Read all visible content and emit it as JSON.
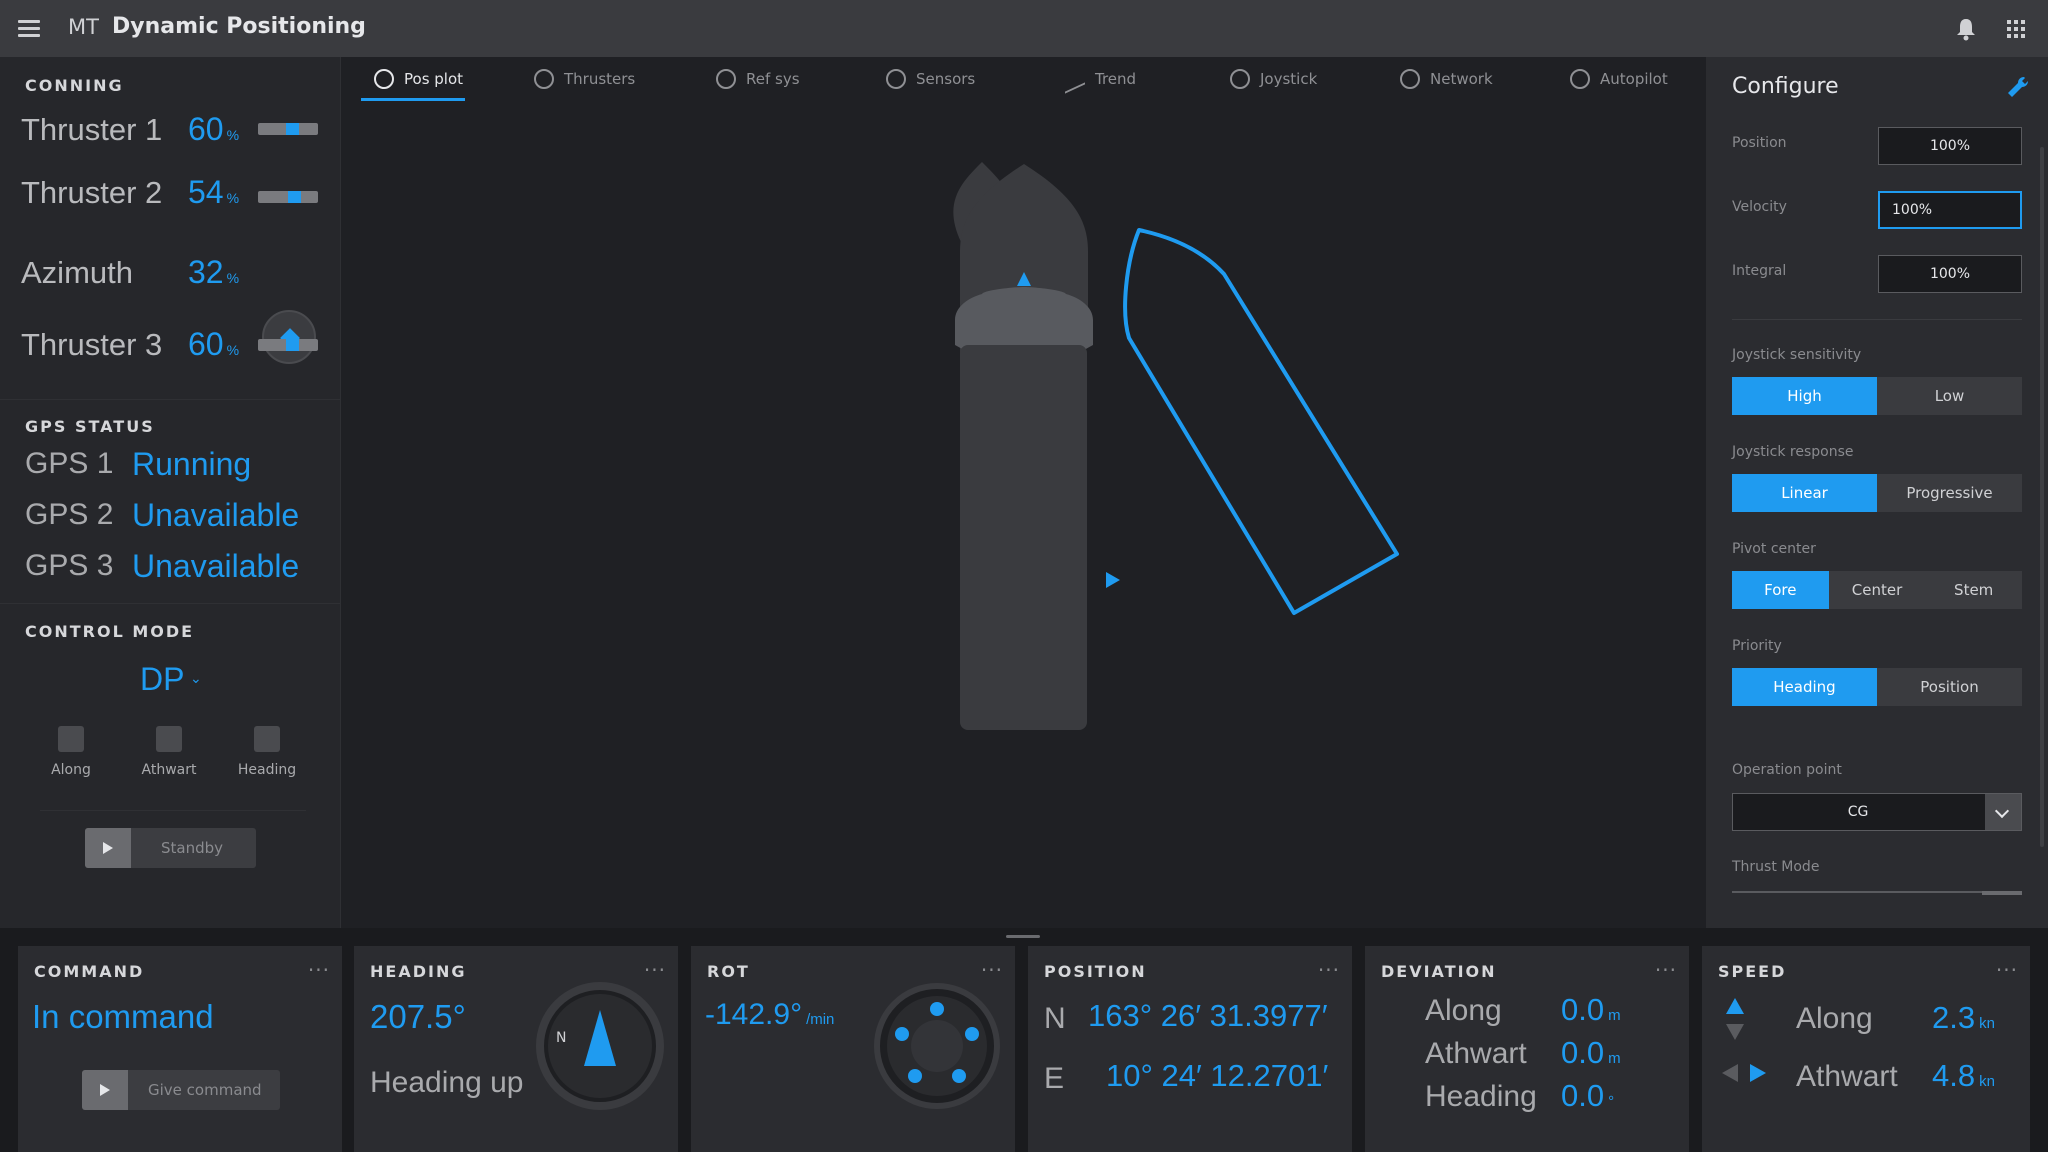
{
  "app": {
    "abbr": "MT",
    "title": "Dynamic Positioning"
  },
  "tabs": [
    {
      "label": "Pos plot",
      "icon": "target-icon"
    },
    {
      "label": "Thrusters",
      "icon": "fan-icon"
    },
    {
      "label": "Ref sys",
      "icon": "circle-icon"
    },
    {
      "label": "Sensors",
      "icon": "antenna-icon"
    },
    {
      "label": "Trend",
      "icon": "trend-icon"
    },
    {
      "label": "Joystick",
      "icon": "joystick-icon"
    },
    {
      "label": "Network",
      "icon": "network-icon"
    },
    {
      "label": "Autopilot",
      "icon": "autopilot-icon"
    }
  ],
  "conning": {
    "title": "CONNING",
    "thrusters": [
      {
        "label": "Thruster 1",
        "value": "60",
        "unit": "%"
      },
      {
        "label": "Thruster 2",
        "value": "54",
        "unit": "%"
      },
      {
        "label": "Azimuth",
        "value": "32",
        "unit": "%"
      },
      {
        "label": "Thruster 3",
        "value": "60",
        "unit": "%"
      }
    ]
  },
  "gps": {
    "title": "GPS STATUS",
    "items": [
      {
        "label": "GPS 1",
        "status": "Running"
      },
      {
        "label": "GPS 2",
        "status": "Unavailable"
      },
      {
        "label": "GPS 3",
        "status": "Unavailable"
      }
    ]
  },
  "control_mode": {
    "title": "CONTROL MODE",
    "value": "DP",
    "axes": [
      "Along",
      "Athwart",
      "Heading"
    ],
    "standby_label": "Standby"
  },
  "configure": {
    "title": "Configure",
    "gains": [
      {
        "label": "Position",
        "value": "100%"
      },
      {
        "label": "Velocity",
        "value": "100%"
      },
      {
        "label": "Integral",
        "value": "100%"
      }
    ],
    "joystick_sensitivity": {
      "label": "Joystick sensitivity",
      "options": [
        "High",
        "Low"
      ],
      "selected": "High"
    },
    "joystick_response": {
      "label": "Joystick response",
      "options": [
        "Linear",
        "Progressive"
      ],
      "selected": "Linear"
    },
    "pivot_center": {
      "label": "Pivot center",
      "options": [
        "Fore",
        "Center",
        "Stem"
      ],
      "selected": "Fore"
    },
    "priority": {
      "label": "Priority",
      "options": [
        "Heading",
        "Position"
      ],
      "selected": "Heading"
    },
    "operation_point": {
      "label": "Operation point",
      "value": "CG"
    },
    "thrust_mode": {
      "label": "Thrust Mode"
    }
  },
  "bottom": {
    "command": {
      "title": "COMMAND",
      "status": "In command",
      "button": "Give command"
    },
    "heading": {
      "title": "HEADING",
      "value": "207.5°",
      "mode": "Heading up",
      "north": "N"
    },
    "rot": {
      "title": "ROT",
      "value": "-142.9°",
      "unit": "/min"
    },
    "position": {
      "title": "POSITION",
      "n_label": "N",
      "n_value": "163° 26′ 31.3977′",
      "e_label": "E",
      "e_value": "10° 24′ 12.2701′"
    },
    "deviation": {
      "title": "DEVIATION",
      "rows": [
        {
          "label": "Along",
          "value": "0.0",
          "unit": "m"
        },
        {
          "label": "Athwart",
          "value": "0.0",
          "unit": "m"
        },
        {
          "label": "Heading",
          "value": "0.0",
          "unit": "°"
        }
      ]
    },
    "speed": {
      "title": "SPEED",
      "rows": [
        {
          "label": "Along",
          "value": "2.3",
          "unit": "kn"
        },
        {
          "label": "Athwart",
          "value": "4.8",
          "unit": "kn"
        }
      ]
    },
    "more": "···"
  },
  "colors": {
    "accent": "#1f9bf0",
    "background": "#1f2024",
    "panel": "#26272b"
  }
}
